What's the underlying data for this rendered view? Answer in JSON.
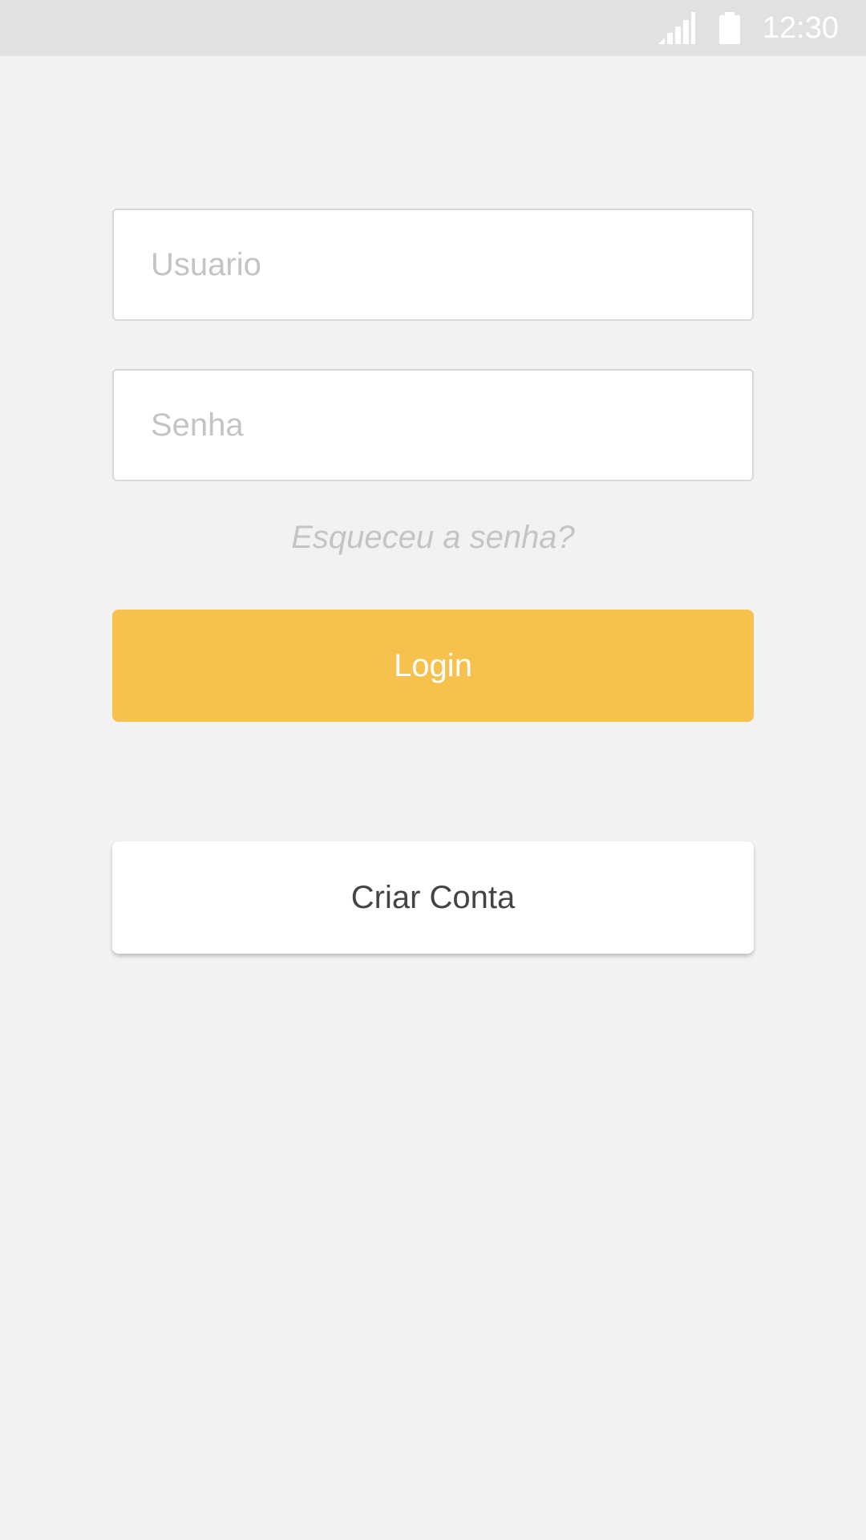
{
  "status_bar": {
    "time": "12:30",
    "icons": [
      "signal-icon",
      "battery-icon"
    ],
    "text_color": "#ffffff",
    "background": "#e1e1e1"
  },
  "login_form": {
    "username_placeholder": "Usuario",
    "username_value": "",
    "password_placeholder": "Senha",
    "password_value": "",
    "forgot_password_label": "Esqueceu a senha?",
    "login_label": "Login",
    "create_account_label": "Criar Conta"
  },
  "colors": {
    "accent": "#f6c14c",
    "background": "#f2f2f2",
    "placeholder": "#c4c4c4",
    "field_border": "#d8d8d8"
  }
}
